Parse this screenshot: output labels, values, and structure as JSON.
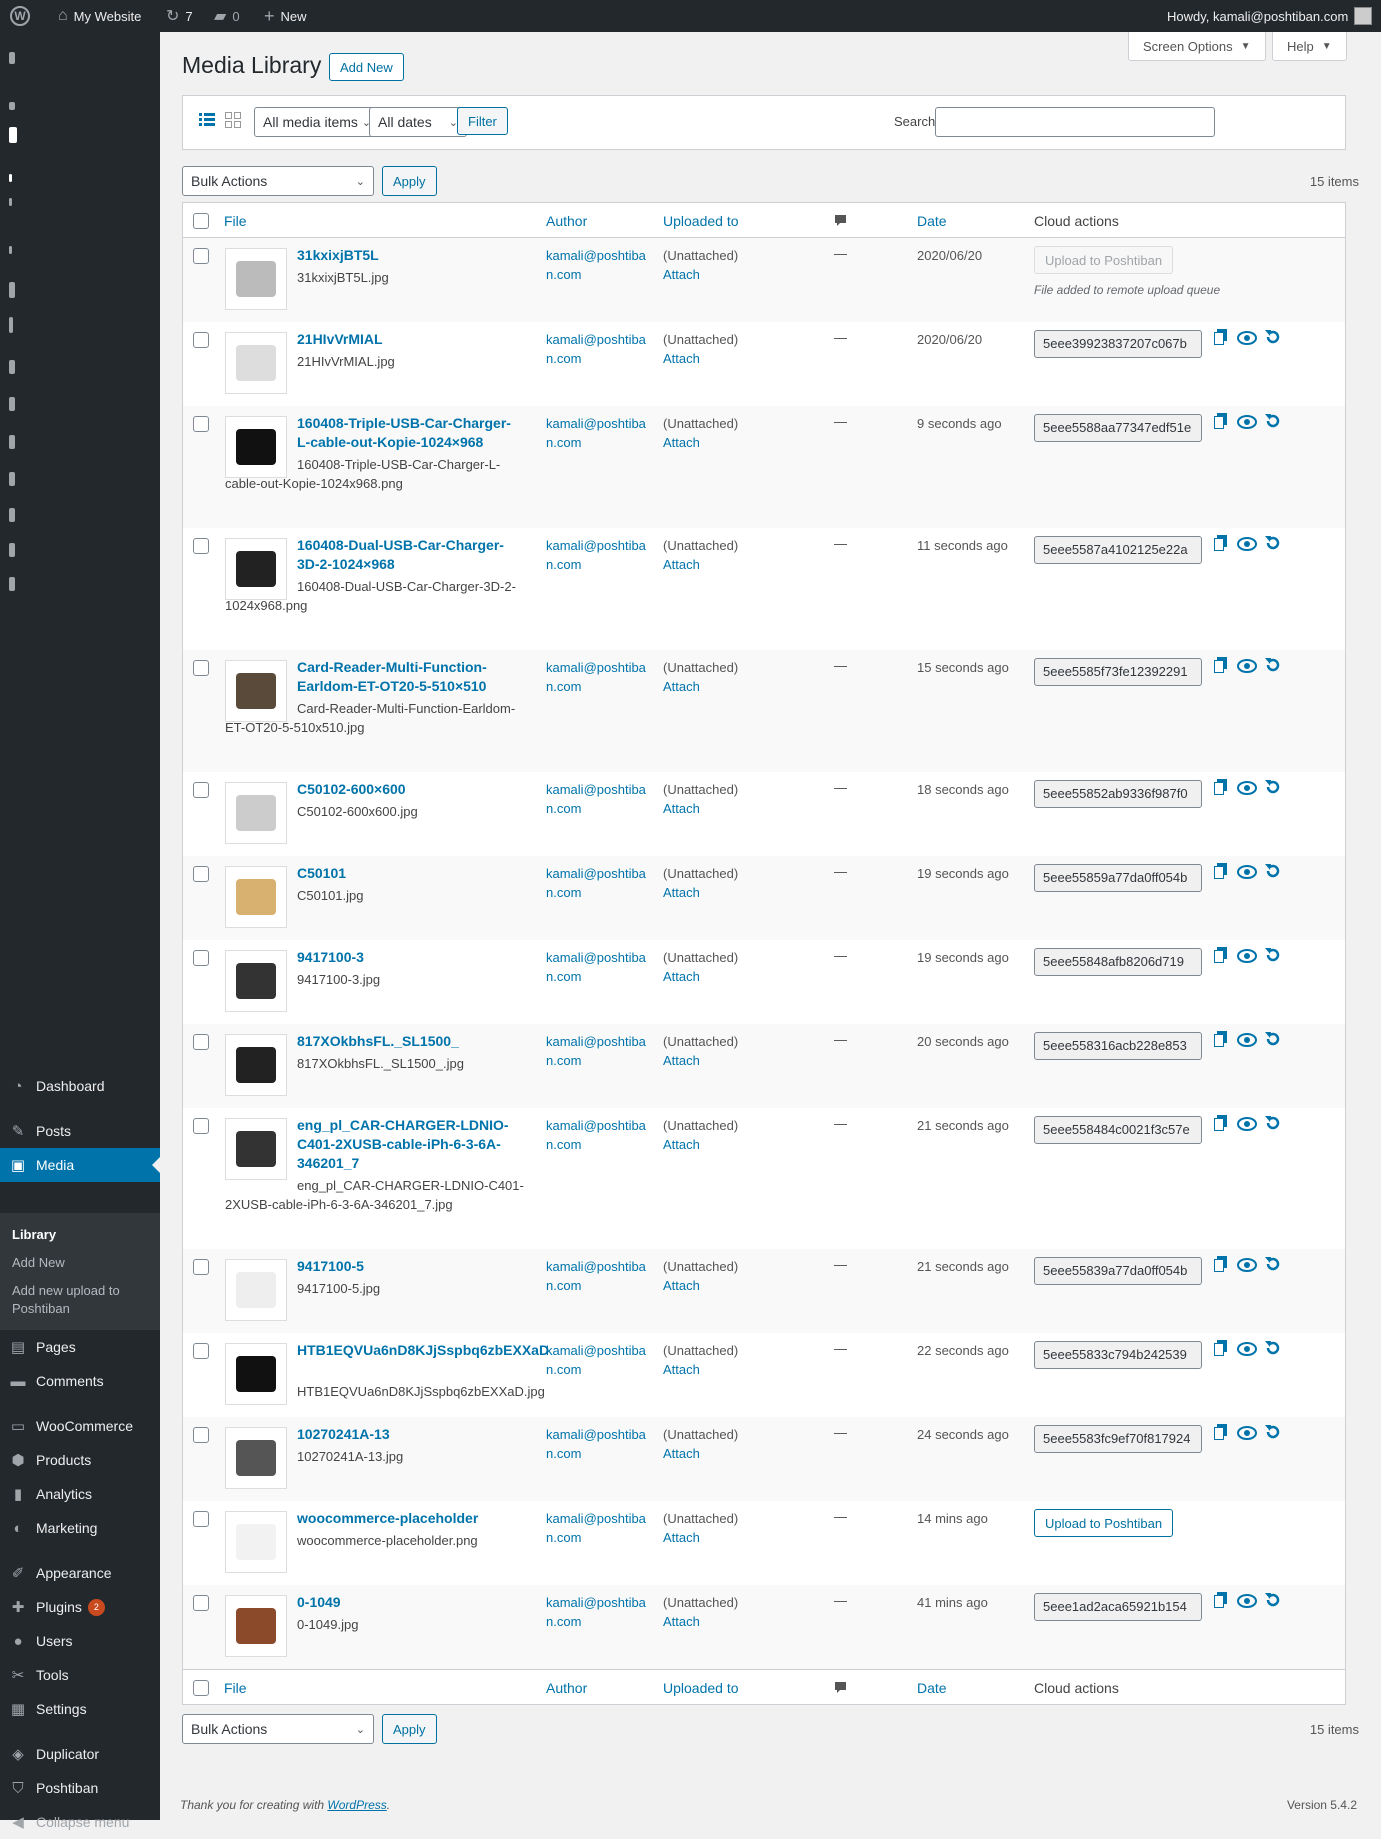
{
  "adminbar": {
    "site": "My Website",
    "updates": "7",
    "comments": "0",
    "new": "New",
    "howdy": "Howdy, kamali@poshtiban.com"
  },
  "sidebar": {
    "items": [
      {
        "label": "Dashboard",
        "icon": "dashboard-icon",
        "glyph": "◔"
      },
      {
        "label": "Posts",
        "icon": "pin-icon",
        "glyph": "✎"
      },
      {
        "label": "Media",
        "icon": "media-icon",
        "glyph": "▣"
      },
      {
        "label": "Pages",
        "icon": "page-icon",
        "glyph": "▤"
      },
      {
        "label": "Comments",
        "icon": "comment-icon",
        "glyph": "▬"
      },
      {
        "label": "WooCommerce",
        "icon": "woo-icon",
        "glyph": "▭"
      },
      {
        "label": "Products",
        "icon": "box-icon",
        "glyph": "⬢"
      },
      {
        "label": "Analytics",
        "icon": "bar-chart-icon",
        "glyph": "▮"
      },
      {
        "label": "Marketing",
        "icon": "megaphone-icon",
        "glyph": "◐"
      },
      {
        "label": "Appearance",
        "icon": "brush-icon",
        "glyph": "✐"
      },
      {
        "label": "Plugins",
        "icon": "plugin-icon",
        "glyph": "✚",
        "badge": "2"
      },
      {
        "label": "Users",
        "icon": "user-icon",
        "glyph": "●"
      },
      {
        "label": "Tools",
        "icon": "wrench-icon",
        "glyph": "✂"
      },
      {
        "label": "Settings",
        "icon": "settings-icon",
        "glyph": "▦"
      },
      {
        "label": "Duplicator",
        "icon": "duplicator-icon",
        "glyph": "◈"
      },
      {
        "label": "Poshtiban",
        "icon": "shield-icon",
        "glyph": "⛉"
      },
      {
        "label": "Collapse menu",
        "icon": "collapse-icon",
        "glyph": "◀"
      }
    ],
    "submenu": [
      "Library",
      "Add New",
      "Add new upload to Poshtiban"
    ]
  },
  "header": {
    "title": "Media Library",
    "add_new": "Add New",
    "screen_options": "Screen Options",
    "help": "Help"
  },
  "filters": {
    "type": "All media items",
    "dates": "All dates",
    "filter": "Filter",
    "search_label": "Search",
    "search_value": ""
  },
  "bulk": {
    "label": "Bulk Actions",
    "apply": "Apply",
    "count": "15 items"
  },
  "columns": {
    "file": "File",
    "author": "Author",
    "uploaded": "Uploaded to",
    "date": "Date",
    "cloud": "Cloud actions"
  },
  "rows": [
    {
      "title": "31kxixjBT5L",
      "file": "31kxixjBT5L.jpg",
      "author": "kamali@poshtiban.com",
      "uploaded": "(Unattached)",
      "attach": "Attach",
      "dash": "—",
      "date": "2020/06/20",
      "cloud_button": "Upload to Poshtiban",
      "cloud_note": "File added to remote upload queue"
    },
    {
      "title": "21HIvVrMIAL",
      "file": "21HIvVrMIAL.jpg",
      "author": "kamali@poshtiban.com",
      "uploaded": "(Unattached)",
      "attach": "Attach",
      "dash": "—",
      "date": "2020/06/20",
      "hash": "5eee39923837207c067b"
    },
    {
      "title": "160408-Triple-USB-Car-Charger-L-cable-out-Kopie-1024×968",
      "file": "160408-Triple-USB-Car-Charger-L-cable-out-Kopie-1024x968.png",
      "author": "kamali@poshtiban.com",
      "uploaded": "(Unattached)",
      "attach": "Attach",
      "dash": "—",
      "date": "9 seconds ago",
      "hash": "5eee5588aa77347edf51e"
    },
    {
      "title": "160408-Dual-USB-Car-Charger-3D-2-1024×968",
      "file": "160408-Dual-USB-Car-Charger-3D-2-1024x968.png",
      "author": "kamali@poshtiban.com",
      "uploaded": "(Unattached)",
      "attach": "Attach",
      "dash": "—",
      "date": "11 seconds ago",
      "hash": "5eee5587a4102125e22a"
    },
    {
      "title": "Card-Reader-Multi-Function-Earldom-ET-OT20-5-510×510",
      "file": "Card-Reader-Multi-Function-Earldom-ET-OT20-5-510x510.jpg",
      "author": "kamali@poshtiban.com",
      "uploaded": "(Unattached)",
      "attach": "Attach",
      "dash": "—",
      "date": "15 seconds ago",
      "hash": "5eee5585f73fe12392291"
    },
    {
      "title": "C50102-600×600",
      "file": "C50102-600x600.jpg",
      "author": "kamali@poshtiban.com",
      "uploaded": "(Unattached)",
      "attach": "Attach",
      "dash": "—",
      "date": "18 seconds ago",
      "hash": "5eee55852ab9336f987f0"
    },
    {
      "title": "C50101",
      "file": "C50101.jpg",
      "author": "kamali@poshtiban.com",
      "uploaded": "(Unattached)",
      "attach": "Attach",
      "dash": "—",
      "date": "19 seconds ago",
      "hash": "5eee55859a77da0ff054b"
    },
    {
      "title": "9417100-3",
      "file": "9417100-3.jpg",
      "author": "kamali@poshtiban.com",
      "uploaded": "(Unattached)",
      "attach": "Attach",
      "dash": "—",
      "date": "19 seconds ago",
      "hash": "5eee55848afb8206d719"
    },
    {
      "title": "817XOkbhsFL._SL1500_",
      "file": "817XOkbhsFL._SL1500_.jpg",
      "author": "kamali@poshtiban.com",
      "uploaded": "(Unattached)",
      "attach": "Attach",
      "dash": "—",
      "date": "20 seconds ago",
      "hash": "5eee558316acb228e853"
    },
    {
      "title": "eng_pl_CAR-CHARGER-LDNIO-C401-2XUSB-cable-iPh-6-3-6A-346201_7",
      "file": "eng_pl_CAR-CHARGER-LDNIO-C401-2XUSB-cable-iPh-6-3-6A-346201_7.jpg",
      "author": "kamali@poshtiban.com",
      "uploaded": "(Unattached)",
      "attach": "Attach",
      "dash": "—",
      "date": "21 seconds ago",
      "hash": "5eee558484c0021f3c57e"
    },
    {
      "title": "9417100-5",
      "file": "9417100-5.jpg",
      "author": "kamali@poshtiban.com",
      "uploaded": "(Unattached)",
      "attach": "Attach",
      "dash": "—",
      "date": "21 seconds ago",
      "hash": "5eee55839a77da0ff054b"
    },
    {
      "title": "HTB1EQVUa6nD8KJjSspbq6zbEXXaD",
      "file": "HTB1EQVUa6nD8KJjSspbq6zbEXXaD.jpg",
      "author": "kamali@poshtiban.com",
      "uploaded": "(Unattached)",
      "attach": "Attach",
      "dash": "—",
      "date": "22 seconds ago",
      "hash": "5eee55833c794b242539"
    },
    {
      "title": "10270241A-13",
      "file": "10270241A-13.jpg",
      "author": "kamali@poshtiban.com",
      "uploaded": "(Unattached)",
      "attach": "Attach",
      "dash": "—",
      "date": "24 seconds ago",
      "hash": "5eee5583fc9ef70f817924"
    },
    {
      "title": "woocommerce-placeholder",
      "file": "woocommerce-placeholder.png",
      "author": "kamali@poshtiban.com",
      "uploaded": "(Unattached)",
      "attach": "Attach",
      "dash": "—",
      "date": "14 mins ago",
      "cloud_button": "Upload to Poshtiban"
    },
    {
      "title": "0-1049",
      "file": "0-1049.jpg",
      "author": "kamali@poshtiban.com",
      "uploaded": "(Unattached)",
      "attach": "Attach",
      "dash": "—",
      "date": "41 mins ago",
      "hash": "5eee1ad2aca65921b154"
    }
  ],
  "footer": {
    "thanks": "Thank you for creating with ",
    "wordpress": "WordPress",
    "period": ".",
    "version": "Version 5.4.2"
  }
}
